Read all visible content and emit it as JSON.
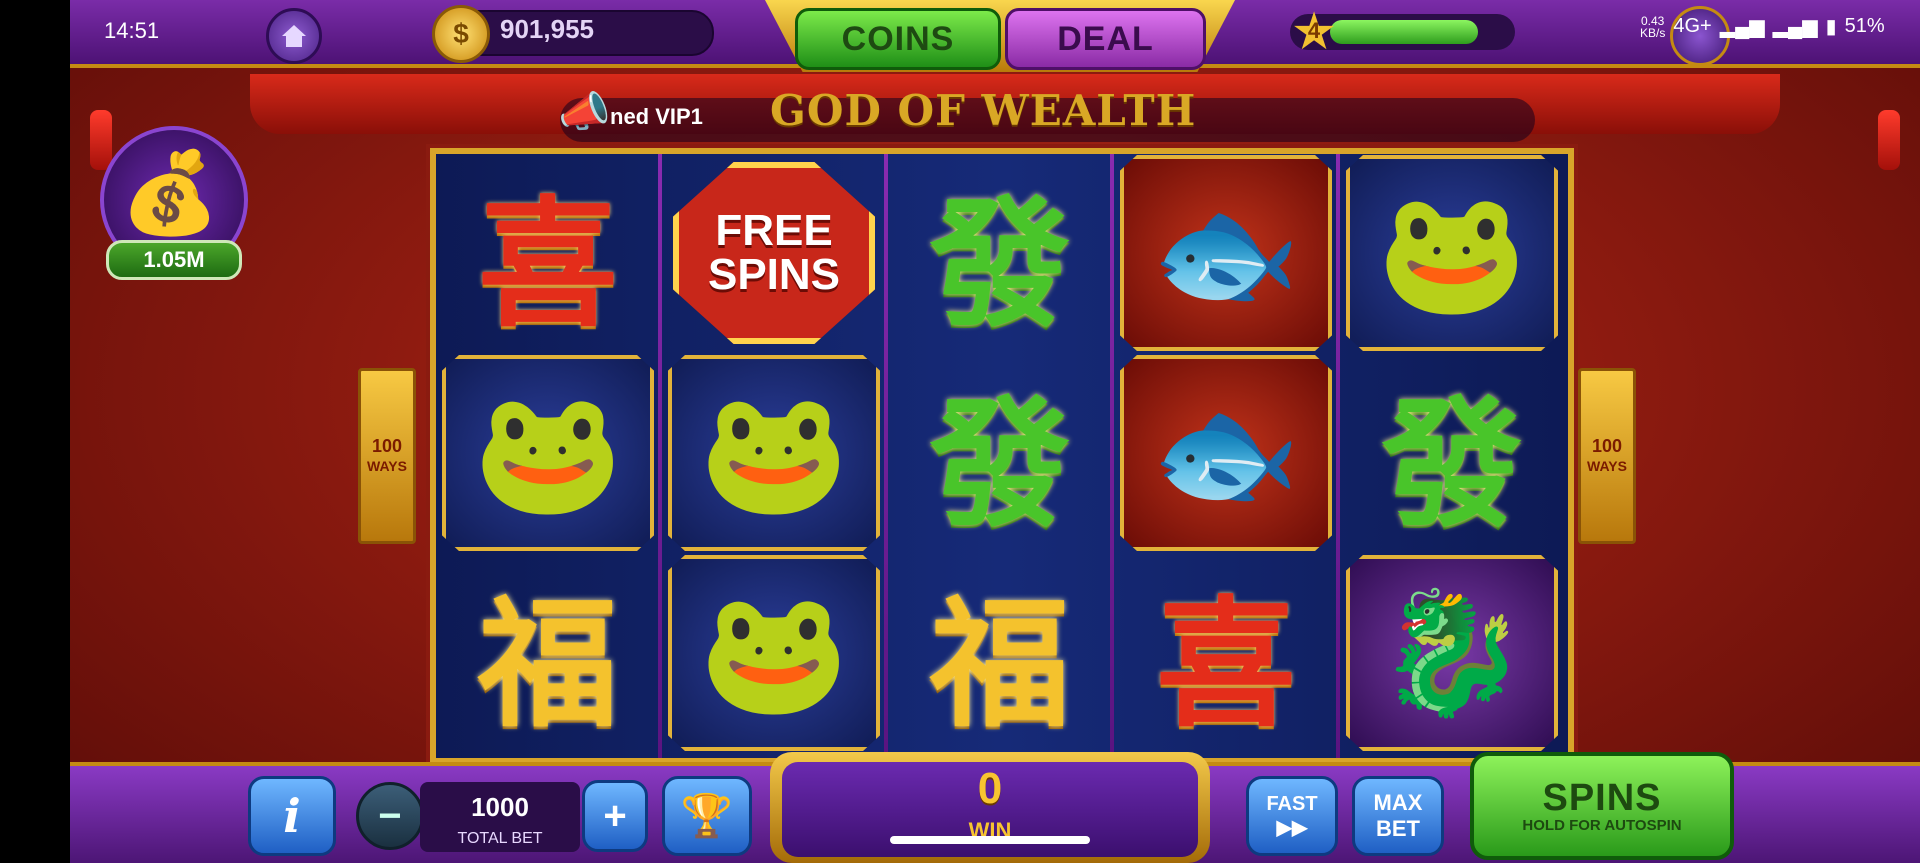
{
  "status_bar": {
    "time": "14:51",
    "net_speed": "0.43",
    "net_unit": "KB/s",
    "network": "4G+",
    "battery": "51%"
  },
  "header": {
    "coin_balance": "901,955",
    "coins_tab": "COINS",
    "deal_tab": "DEAL",
    "level": "4",
    "level_progress": 0.8
  },
  "marquee": {
    "text": "ned VIP1"
  },
  "game": {
    "title": "GOD OF WEALTH",
    "ways": "100",
    "ways_label": "WAYS"
  },
  "jackpot": {
    "value": "1.05M"
  },
  "reels": [
    [
      {
        "symbol": "xi",
        "char": "喜"
      },
      {
        "symbol": "frog"
      },
      {
        "symbol": "fu",
        "char": "福"
      }
    ],
    [
      {
        "symbol": "free-spins",
        "line1": "FREE",
        "line2": "SPINS"
      },
      {
        "symbol": "frog"
      },
      {
        "symbol": "frog"
      }
    ],
    [
      {
        "symbol": "fa",
        "char": "發"
      },
      {
        "symbol": "fa",
        "char": "發"
      },
      {
        "symbol": "fu",
        "char": "福"
      }
    ],
    [
      {
        "symbol": "fish"
      },
      {
        "symbol": "fish"
      },
      {
        "symbol": "xi",
        "char": "喜"
      }
    ],
    [
      {
        "symbol": "frog"
      },
      {
        "symbol": "fa",
        "char": "發"
      },
      {
        "symbol": "dragon"
      }
    ]
  ],
  "controls": {
    "info": "i",
    "minus": "−",
    "plus": "+",
    "total_bet": "1000",
    "total_bet_label": "TOTAL BET",
    "win": "0",
    "win_label": "WIN",
    "fast": "FAST",
    "fast_icon": "▶▶",
    "max_line1": "MAX",
    "max_line2": "BET",
    "spins": "SPINS",
    "spins_sub": "HOLD FOR AUTOSPIN"
  },
  "colors": {
    "accent_gold": "#d8a52a",
    "reel_bg": "#162a78",
    "bar_purple": "#7a2ca8",
    "spin_green": "#2a9a1a"
  }
}
